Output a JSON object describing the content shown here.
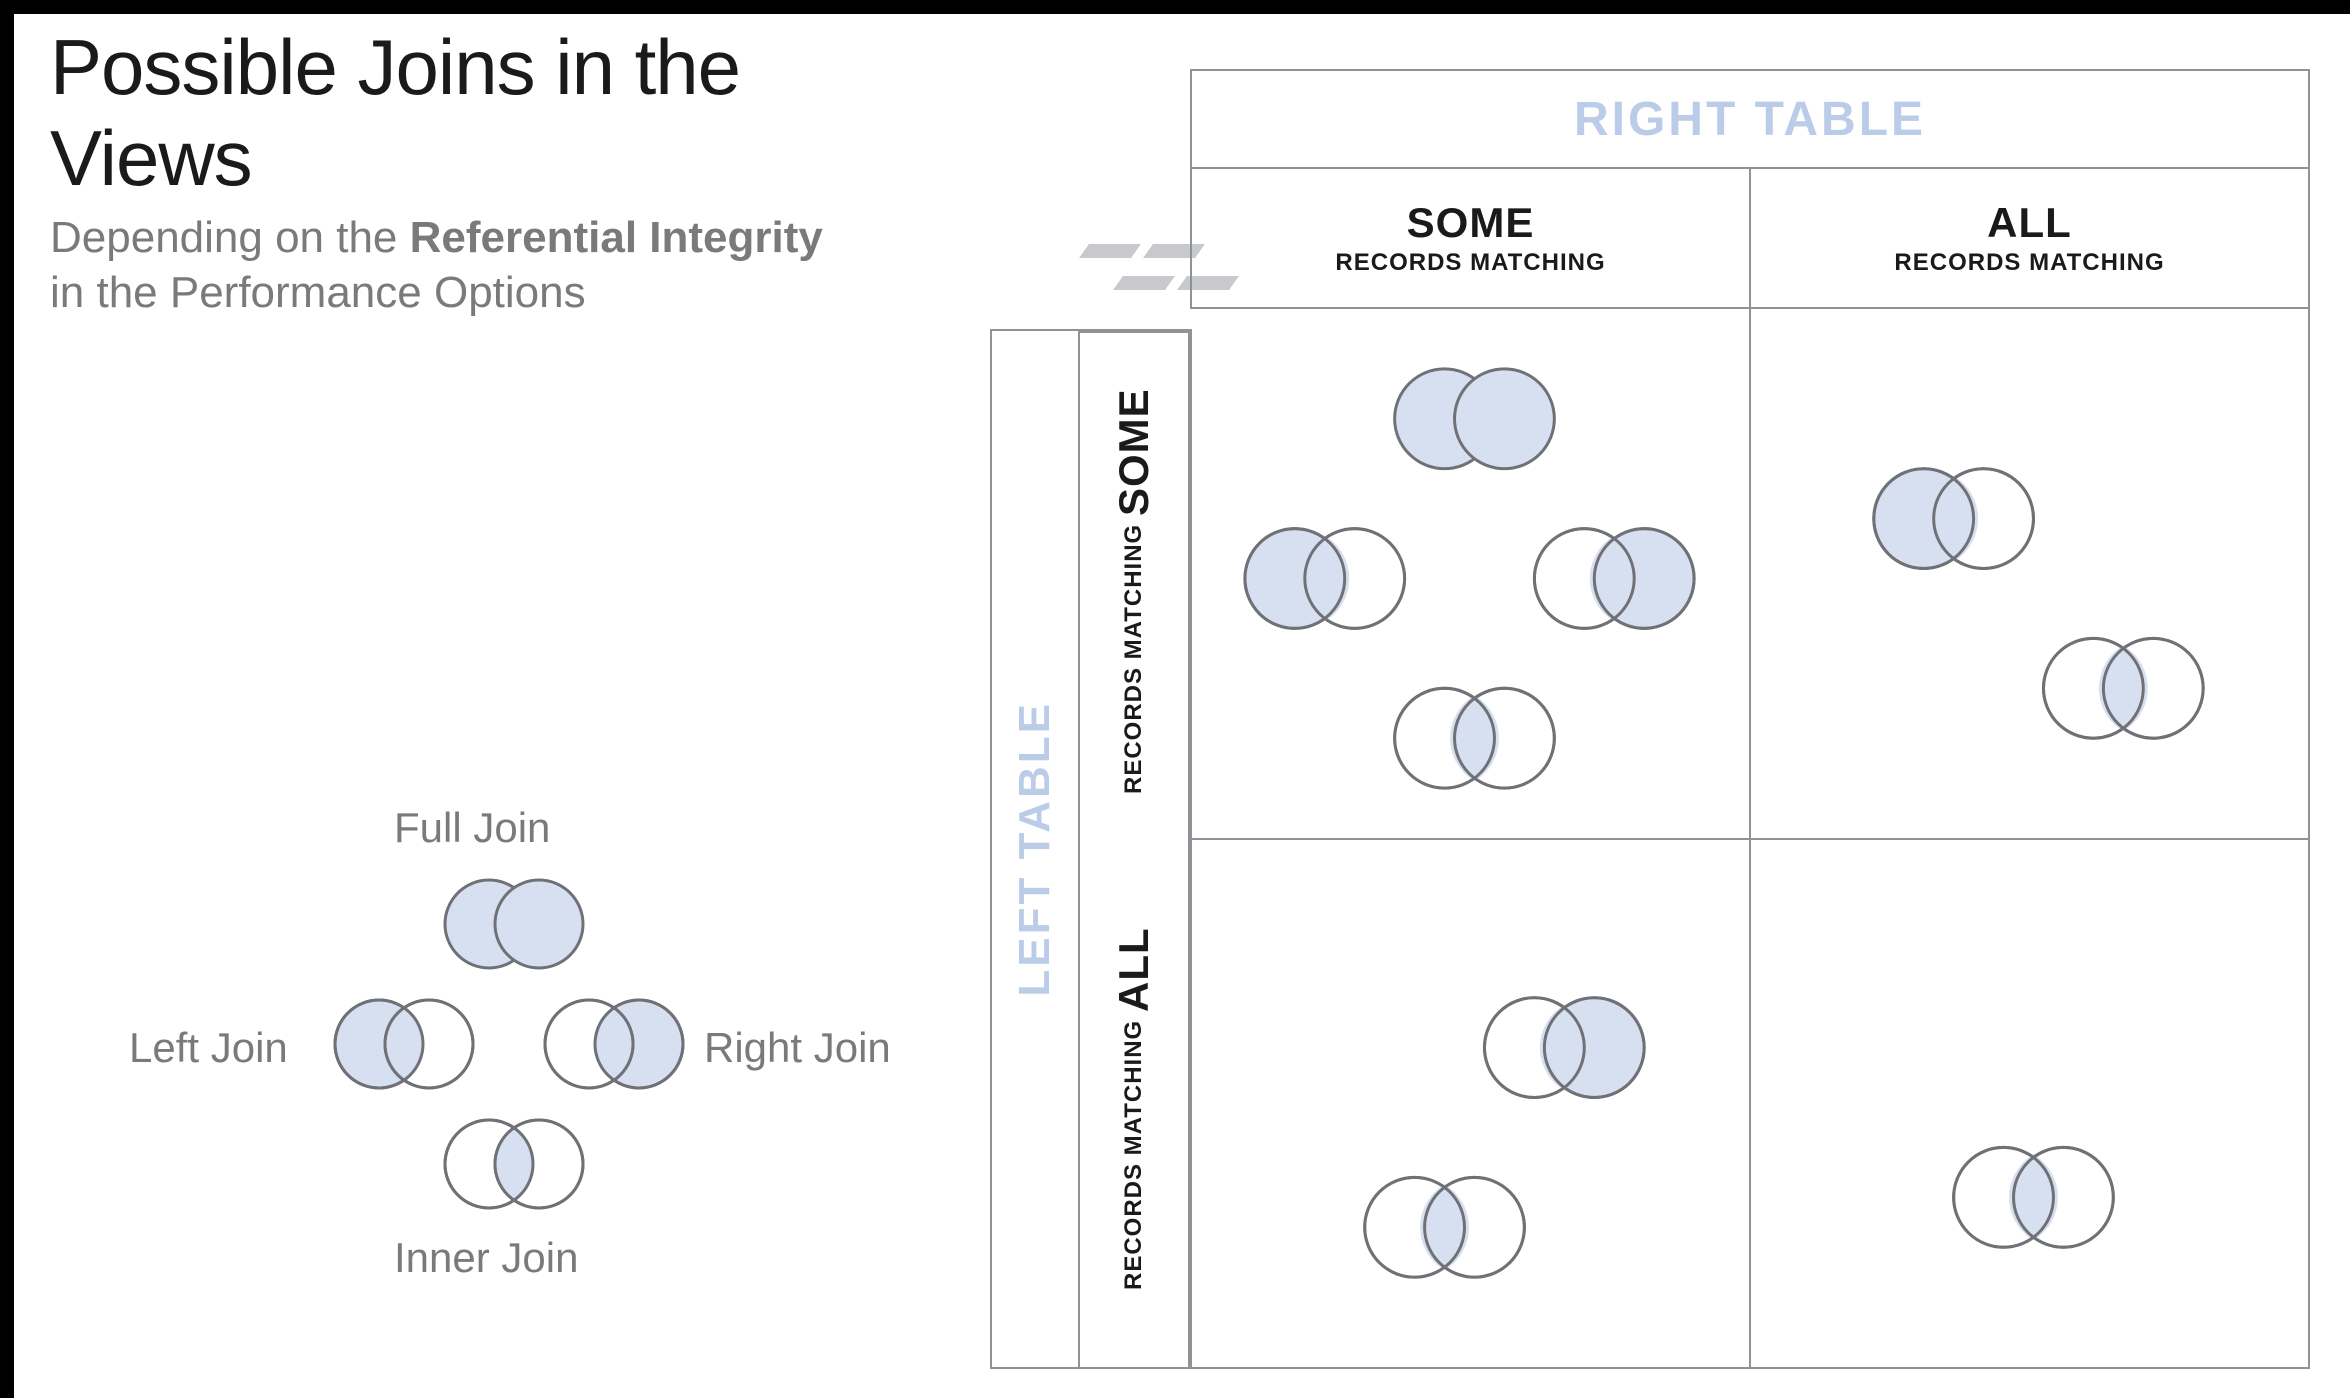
{
  "title": "Possible Joins in the Views",
  "subtitle_prefix": "Depending on the ",
  "subtitle_bold": "Referential Integrity",
  "subtitle_suffix": "in the Performance Options",
  "legend": {
    "full": "Full Join",
    "left": "Left Join",
    "right": "Right Join",
    "inner": "Inner Join"
  },
  "matrix": {
    "right_table": "RIGHT TABLE",
    "left_table": "LEFT TABLE",
    "col_some_big": "SOME",
    "col_some_small": "RECORDS MATCHING",
    "col_all_big": "ALL",
    "col_all_small": "RECORDS MATCHING",
    "row_some_big": "SOME",
    "row_some_small": "RECORDS MATCHING",
    "row_all_big": "ALL",
    "row_all_small": "RECORDS MATCHING"
  },
  "join_cells": {
    "some_some": [
      "full",
      "left",
      "right",
      "inner"
    ],
    "some_all": [
      "left",
      "inner"
    ],
    "all_some": [
      "right",
      "inner"
    ],
    "all_all": [
      "inner"
    ]
  }
}
